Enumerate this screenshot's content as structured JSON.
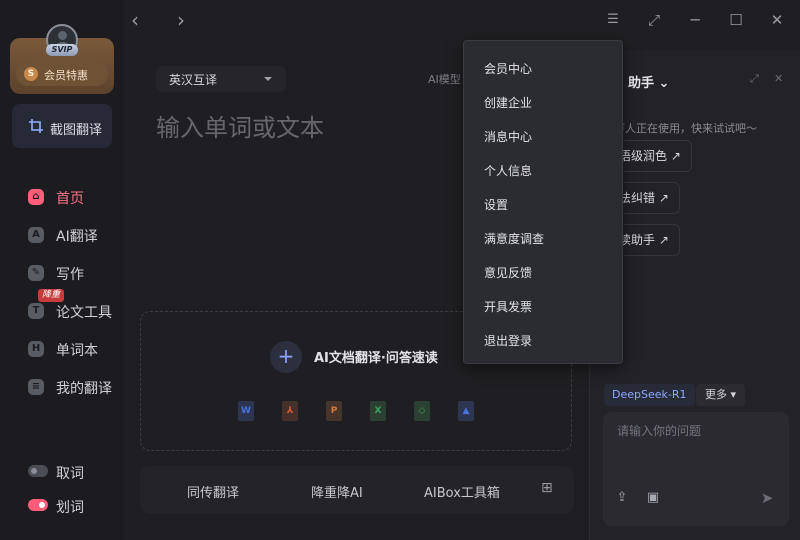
{
  "sidebar": {
    "vip_badge": "SVIP",
    "vip_offer_label": "会员特惠",
    "vip_offer_coin": "S",
    "screenshot_translate_label": "截图翻译",
    "nav_items": [
      {
        "label": "首页",
        "icon": "home-icon",
        "glyph": "⌂",
        "active": true
      },
      {
        "label": "AI翻译",
        "icon": "ai-translate-icon",
        "glyph": "A",
        "active": false
      },
      {
        "label": "写作",
        "icon": "pen-icon",
        "glyph": "✎",
        "active": false
      },
      {
        "label": "论文工具",
        "icon": "paper-icon",
        "glyph": "T",
        "active": false
      },
      {
        "label": "单词本",
        "icon": "wordbook-icon",
        "glyph": "H",
        "active": false
      },
      {
        "label": "我的翻译",
        "icon": "my-translation-icon",
        "glyph": "≡",
        "active": false
      }
    ],
    "paper_tool_badge": "降重",
    "toggles": [
      {
        "label": "取词",
        "on": false
      },
      {
        "label": "划词",
        "on": true
      }
    ]
  },
  "topbar": {
    "back_glyph": "‹",
    "forward_glyph": "›",
    "menu_glyph": "☰",
    "mini_glyph": "⤢",
    "min_glyph": "─",
    "max_glyph": "☐",
    "close_glyph": "✕"
  },
  "main": {
    "lang_pair": "英汉互译",
    "ai_model_label": "AI模型",
    "source_placeholder": "输入单词或文本",
    "upload_plus": "+",
    "upload_label": "AI文档翻译·问答速读",
    "file_types": [
      {
        "icon": "word-file-icon",
        "glyph": "W",
        "color": "#4a70d9"
      },
      {
        "icon": "pdf-file-icon",
        "glyph": "⅄",
        "color": "#d9583a"
      },
      {
        "icon": "ppt-file-icon",
        "glyph": "P",
        "color": "#d9783a"
      },
      {
        "icon": "excel-file-icon",
        "glyph": "X",
        "color": "#3aa15c"
      },
      {
        "icon": "epub-file-icon",
        "glyph": "◇",
        "color": "#3aa15c"
      },
      {
        "icon": "image-file-icon",
        "glyph": "▲",
        "color": "#4a70d9"
      }
    ],
    "tools": [
      "同传翻译",
      "降重降AI",
      "AIBox工具箱"
    ],
    "tools_grid_glyph": "⊞"
  },
  "menu": {
    "items": [
      "会员中心",
      "创建企业",
      "消息中心",
      "个人信息",
      "设置",
      "满意度调查",
      "意见反馈",
      "开具发票",
      "退出登录"
    ]
  },
  "assistant": {
    "title": "助手",
    "title_caret": "⌄",
    "expand_glyph": "⤢",
    "close_glyph": "✕",
    "hint": "万人正在使用，快来试试吧～",
    "chips": [
      "语级润色 ↗",
      "法纠错 ↗",
      "读助手 ↗"
    ],
    "model": "DeepSeek-R1",
    "more": "更多 ▾",
    "input_placeholder": "请输入你的问题",
    "upload_glyph": "⇪",
    "image_glyph": "▣",
    "send_glyph": "➤"
  },
  "colors": {
    "accent_pink": "#ff5d7a",
    "accent_blue": "#8fa6ff",
    "vip_gold": "#7a5a3c"
  }
}
